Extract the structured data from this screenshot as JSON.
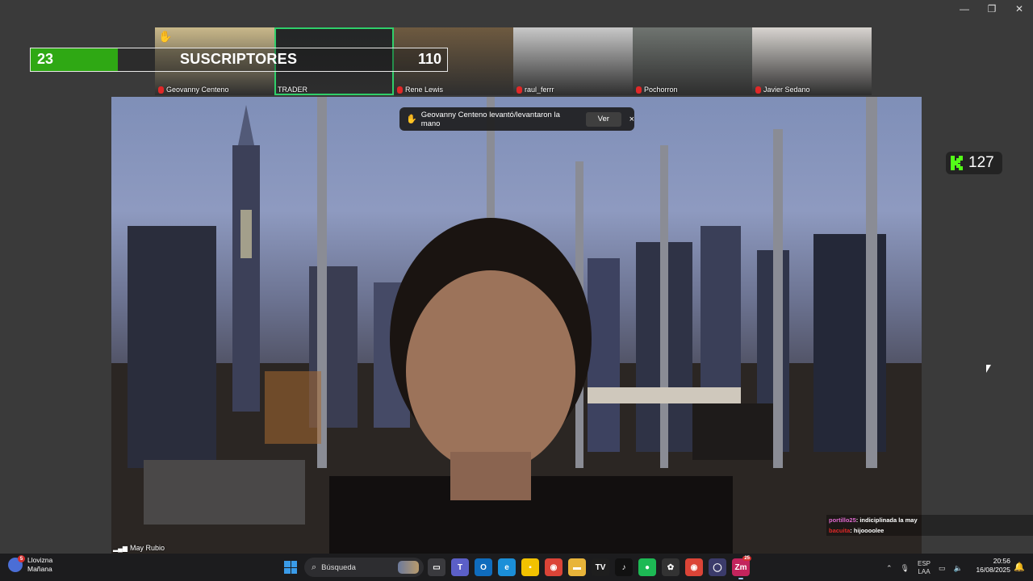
{
  "window": {
    "minimize": "—",
    "restore": "❐",
    "close": "✕"
  },
  "subscribers": {
    "count": "23",
    "label": "SUSCRIPTORES",
    "goal": "110",
    "progress_fraction": 0.209
  },
  "participants": [
    {
      "name": "Geovanny Centeno",
      "muted": true,
      "hand_raised": true,
      "active": false
    },
    {
      "name": "TRADER",
      "muted": false,
      "hand_raised": false,
      "active": true
    },
    {
      "name": "Rene Lewis",
      "muted": true,
      "hand_raised": false,
      "active": false
    },
    {
      "name": "raul_ferrr",
      "muted": true,
      "hand_raised": false,
      "active": false
    },
    {
      "name": "Pochorron",
      "muted": true,
      "hand_raised": false,
      "active": false
    },
    {
      "name": "Javier Sedano",
      "muted": true,
      "hand_raised": false,
      "active": false
    }
  ],
  "main_video": {
    "name": "May Rubio"
  },
  "notification": {
    "text": "Geovanny Centeno levantó/levantaron la mano",
    "action": "Ver",
    "close": "×"
  },
  "kick": {
    "viewers": "127",
    "color": "#53fc18"
  },
  "chat": [
    {
      "user": "portillo25",
      "message": ": indiciplinada la may"
    },
    {
      "user": "bacuita",
      "message": ": hijoooolee"
    }
  ],
  "taskbar": {
    "weather_title": "Llovizna",
    "weather_sub": "Mañana",
    "weather_badge": "5",
    "search_placeholder": "Búsqueda",
    "apps": [
      {
        "name": "task-view",
        "glyph": "▭",
        "color": "#3a3a3e"
      },
      {
        "name": "teams",
        "glyph": "T",
        "color": "#5b5fc7"
      },
      {
        "name": "outlook",
        "glyph": "O",
        "color": "#0f6cbd"
      },
      {
        "name": "edge",
        "glyph": "e",
        "color": "#1b8fd8"
      },
      {
        "name": "sticky-notes",
        "glyph": "▪",
        "color": "#f2c200"
      },
      {
        "name": "chrome",
        "glyph": "◉",
        "color": "#db4437"
      },
      {
        "name": "file-explorer",
        "glyph": "▬",
        "color": "#e8b43a"
      },
      {
        "name": "tradingview",
        "glyph": "TV",
        "color": "#1e1e1e"
      },
      {
        "name": "tiktok",
        "glyph": "♪",
        "color": "#111111"
      },
      {
        "name": "spotify",
        "glyph": "●",
        "color": "#1db954"
      },
      {
        "name": "openai",
        "glyph": "✿",
        "color": "#333333"
      },
      {
        "name": "chrome-2",
        "glyph": "◉",
        "color": "#db4437"
      },
      {
        "name": "app-circle",
        "glyph": "◯",
        "color": "#3b3b6b"
      },
      {
        "name": "zoom",
        "glyph": "Zm",
        "color": "#c3245d",
        "badge": "25",
        "active": true
      }
    ],
    "language_top": "ESP",
    "language_bottom": "LAA",
    "time": "20:56",
    "date": "16/08/2025"
  }
}
